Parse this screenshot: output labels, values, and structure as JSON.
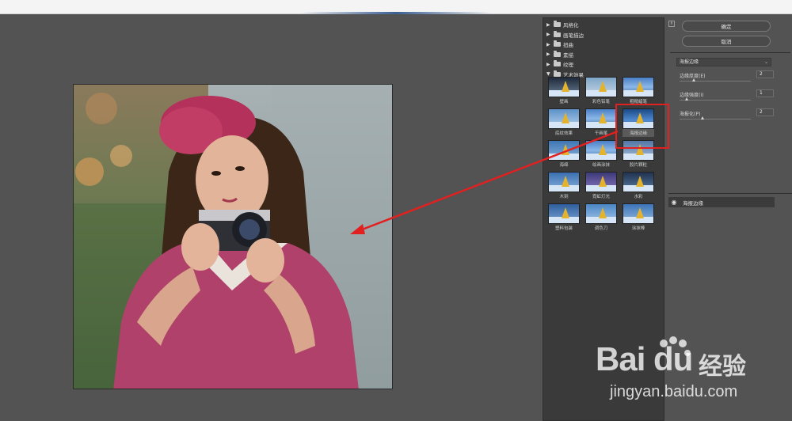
{
  "preview": {
    "description_icon": "posterized-photo-girl-camera"
  },
  "filter_gallery": {
    "folders": [
      {
        "label": "风格化",
        "expanded": false
      },
      {
        "label": "画笔描边",
        "expanded": false
      },
      {
        "label": "扭曲",
        "expanded": false
      },
      {
        "label": "素描",
        "expanded": false
      },
      {
        "label": "纹理",
        "expanded": false
      },
      {
        "label": "艺术效果",
        "expanded": true
      }
    ],
    "filters": [
      {
        "label": "壁画"
      },
      {
        "label": "彩色铅笔"
      },
      {
        "label": "粗糙蜡笔"
      },
      {
        "label": "底纹效果"
      },
      {
        "label": "干画笔"
      },
      {
        "label": "海报边缘",
        "selected": true
      },
      {
        "label": "海绵"
      },
      {
        "label": "绘画涂抹"
      },
      {
        "label": "胶片颗粒"
      },
      {
        "label": "木刻"
      },
      {
        "label": "霓虹灯光"
      },
      {
        "label": "水彩"
      },
      {
        "label": "塑料包装"
      },
      {
        "label": "调色刀"
      },
      {
        "label": "涂抹棒"
      }
    ]
  },
  "buttons": {
    "ok": "确定",
    "cancel": "取消"
  },
  "settings": {
    "filter_select": "海报边缘",
    "params": [
      {
        "label": "边缘厚度(E)",
        "value": "2",
        "level": 0.2
      },
      {
        "label": "边缘强度(I)",
        "value": "1",
        "level": 0.1
      },
      {
        "label": "海报化(P)",
        "value": "2",
        "level": 0.33
      }
    ]
  },
  "layers": {
    "items": [
      {
        "label": "海报边缘",
        "visible": true
      }
    ]
  },
  "annotation": {
    "highlight_color": "#e12020"
  },
  "watermark": {
    "logo": "Bai du",
    "brand_cn": "经验",
    "url": "jingyan.baidu.com"
  }
}
